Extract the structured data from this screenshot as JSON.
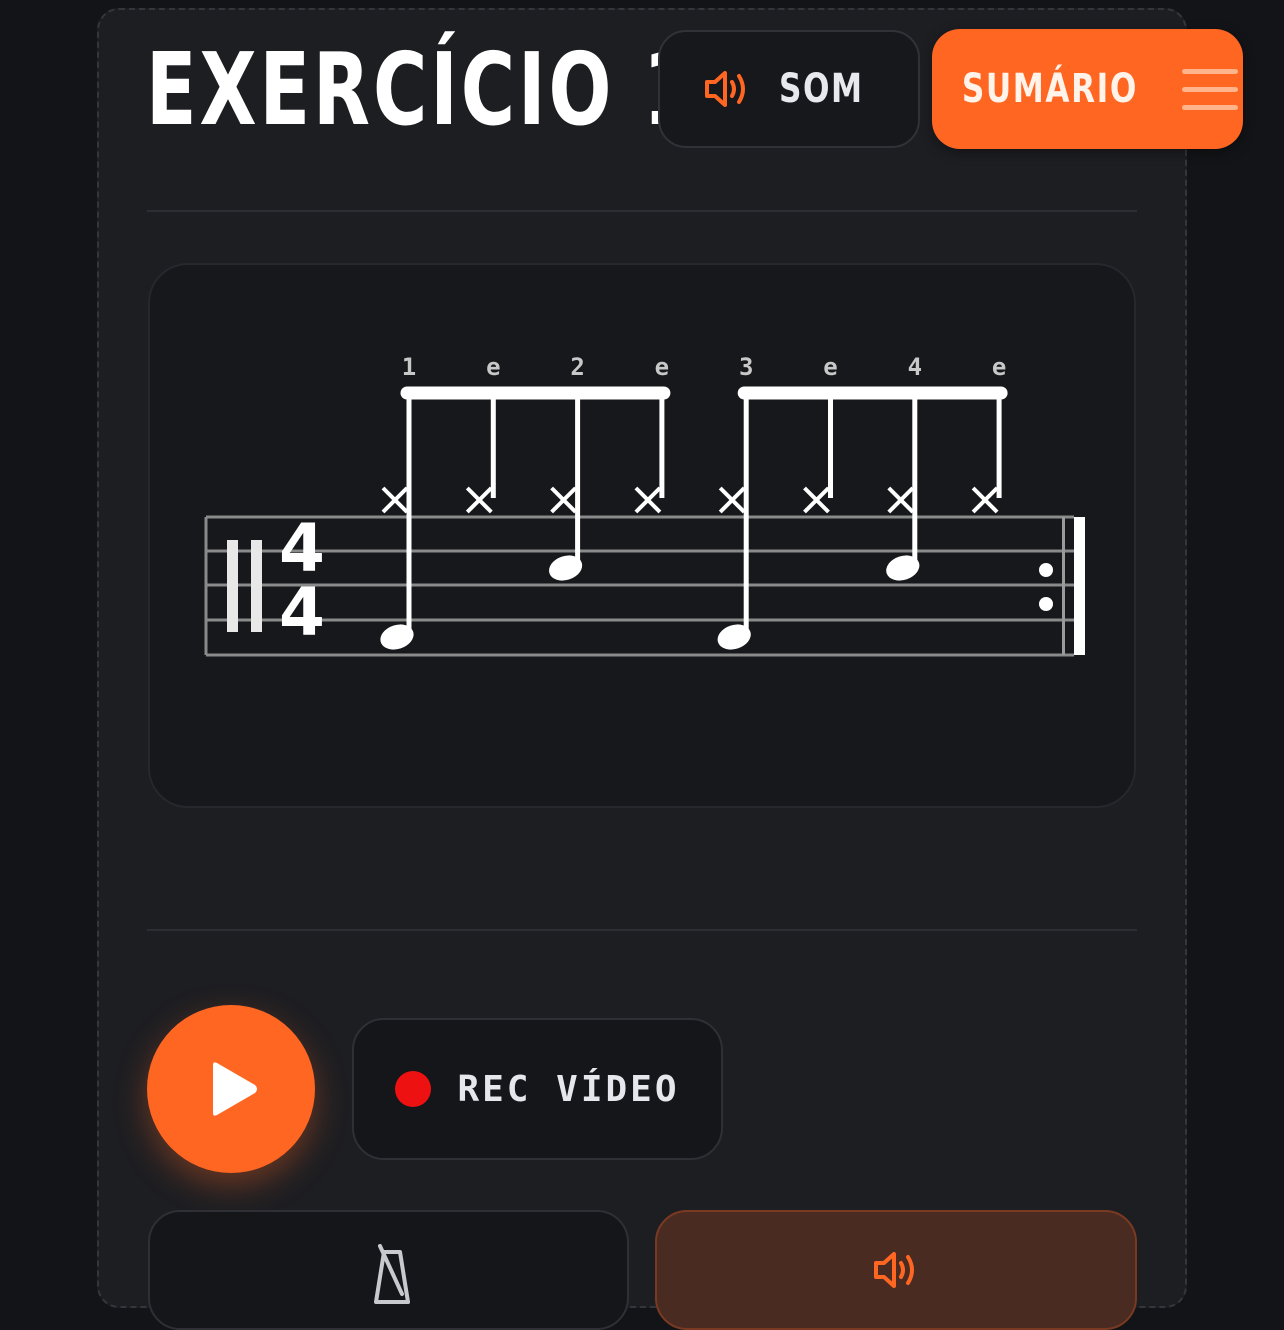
{
  "header": {
    "title": "EXERCÍCIO 1",
    "som_label": "SOM",
    "sumario_label": "SUMÁRIO"
  },
  "score": {
    "time_signature": {
      "top": "4",
      "bottom": "4"
    },
    "counts": [
      "1",
      "e",
      "2",
      "e",
      "3",
      "e",
      "4",
      "e"
    ],
    "notes": [
      {
        "count": "1",
        "hihat": true,
        "kick": true,
        "snare": false
      },
      {
        "count": "e",
        "hihat": true,
        "kick": false,
        "snare": false
      },
      {
        "count": "2",
        "hihat": true,
        "kick": false,
        "snare": true
      },
      {
        "count": "e",
        "hihat": true,
        "kick": false,
        "snare": false
      },
      {
        "count": "3",
        "hihat": true,
        "kick": true,
        "snare": false
      },
      {
        "count": "e",
        "hihat": true,
        "kick": false,
        "snare": false
      },
      {
        "count": "4",
        "hihat": true,
        "kick": false,
        "snare": true
      },
      {
        "count": "e",
        "hihat": true,
        "kick": false,
        "snare": false
      }
    ],
    "repeat_end": true
  },
  "controls": {
    "play_icon": "play-icon",
    "rec_label": "REC VÍDEO",
    "metronome_icon": "metronome-icon",
    "volume_icon": "speaker-icon"
  },
  "colors": {
    "accent": "#ff6622",
    "rec_dot": "#ee1111",
    "background": "#1d1e22"
  }
}
